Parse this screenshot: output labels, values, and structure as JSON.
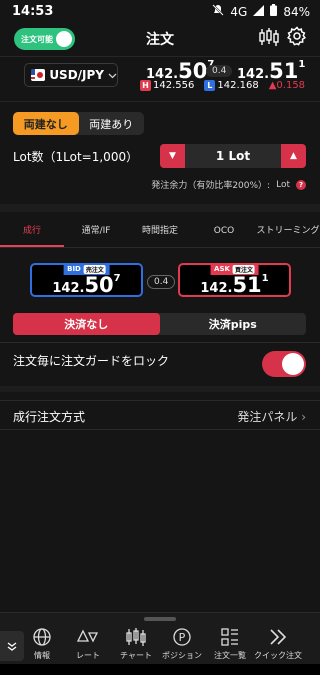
{
  "status": {
    "time": "14:53",
    "network": "4G",
    "battery": "84%"
  },
  "header": {
    "title": "注文",
    "toggle_label": "注文可能"
  },
  "ticker": {
    "symbol": "USD/JPY",
    "bid_prefix": "142.",
    "bid_big": "50",
    "bid_sup": "7",
    "spread": "0.4",
    "ask_prefix": "142.",
    "ask_big": "51",
    "ask_sup": "1",
    "high_badge": "H",
    "high": "142.556",
    "low_badge": "L",
    "low": "142.168",
    "change": "▲0.158"
  },
  "hedge": {
    "off": "両建なし",
    "on": "両建あり"
  },
  "lot": {
    "label": "Lot数（1Lot=1,000）",
    "minus": "▼",
    "value": "1 Lot",
    "plus": "▲",
    "margin_label": "発注余力（有効比率200%）:",
    "margin_value": "Lot",
    "help": "?"
  },
  "tabs": [
    "成行",
    "通常/IF",
    "時間指定",
    "OCO",
    "ストリーミング"
  ],
  "quote": {
    "bid_label": "BID",
    "bid_tag": "売注文",
    "bid_prefix": "142.",
    "bid_big": "50",
    "bid_sup": "7",
    "spread": "0.4",
    "ask_label": "ASK",
    "ask_tag": "買注文",
    "ask_prefix": "142.",
    "ask_big": "51",
    "ask_sup": "1"
  },
  "settle": {
    "off": "決済なし",
    "pips": "決済pips"
  },
  "guard": {
    "label": "注文毎に注文ガードをロック"
  },
  "method": {
    "label": "成行注文方式",
    "value": "発注パネル",
    "chevron": "›"
  },
  "nav": [
    {
      "label": "情報"
    },
    {
      "label": "レート"
    },
    {
      "label": "チャート"
    },
    {
      "label": "ポジション"
    },
    {
      "label": "注文一覧"
    },
    {
      "label": "クイック注文"
    }
  ],
  "colors": {
    "accent": "#d6334a",
    "toggle_green": "#2ec27e",
    "hedge_orange": "#f59b23",
    "bid_blue": "#2f6fe0",
    "ask_red": "#e23a4f"
  }
}
